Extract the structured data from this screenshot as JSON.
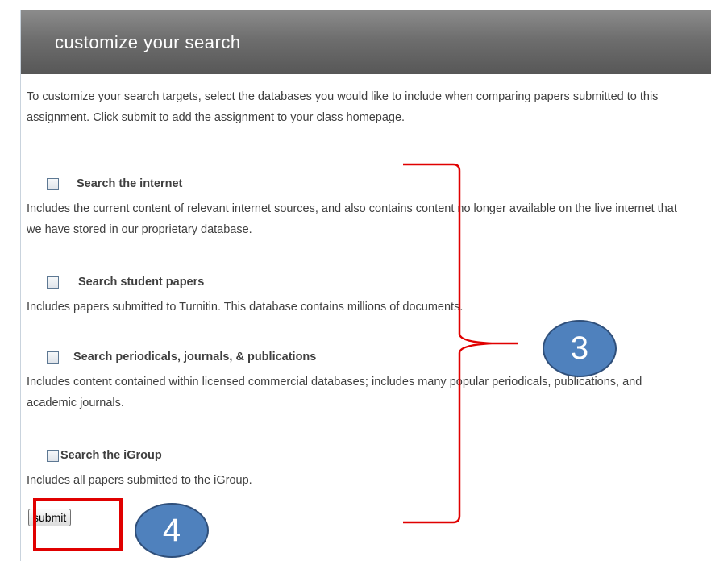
{
  "header": {
    "title": "customize your search"
  },
  "intro": "To customize your search targets, select the databases you would like to include when comparing papers submitted to this assignment. Click submit to add the assignment to your class homepage.",
  "options": [
    {
      "label": "Search the internet",
      "description": "Includes the current content of relevant internet sources, and also contains content no longer available on the live internet that we have stored in our proprietary database.",
      "checked": false
    },
    {
      "label": "Search student papers",
      "description": "Includes papers submitted to Turnitin. This database contains millions of documents.",
      "checked": false
    },
    {
      "label": "Search periodicals, journals, & publications",
      "description": "Includes content contained within licensed commercial databases; includes many popular periodicals, publications, and academic journals.",
      "checked": false
    },
    {
      "label": "Search the iGroup",
      "description": "Includes all papers submitted to the iGroup.",
      "checked": false
    }
  ],
  "submit_label": "submit",
  "annotations": {
    "callout_3": "3",
    "callout_4": "4",
    "highlight_color": "#e00000",
    "callout_color": "#4f81bd"
  },
  "colors": {
    "header_bg": "#6e6e6e",
    "text": "#3f3f3f"
  }
}
